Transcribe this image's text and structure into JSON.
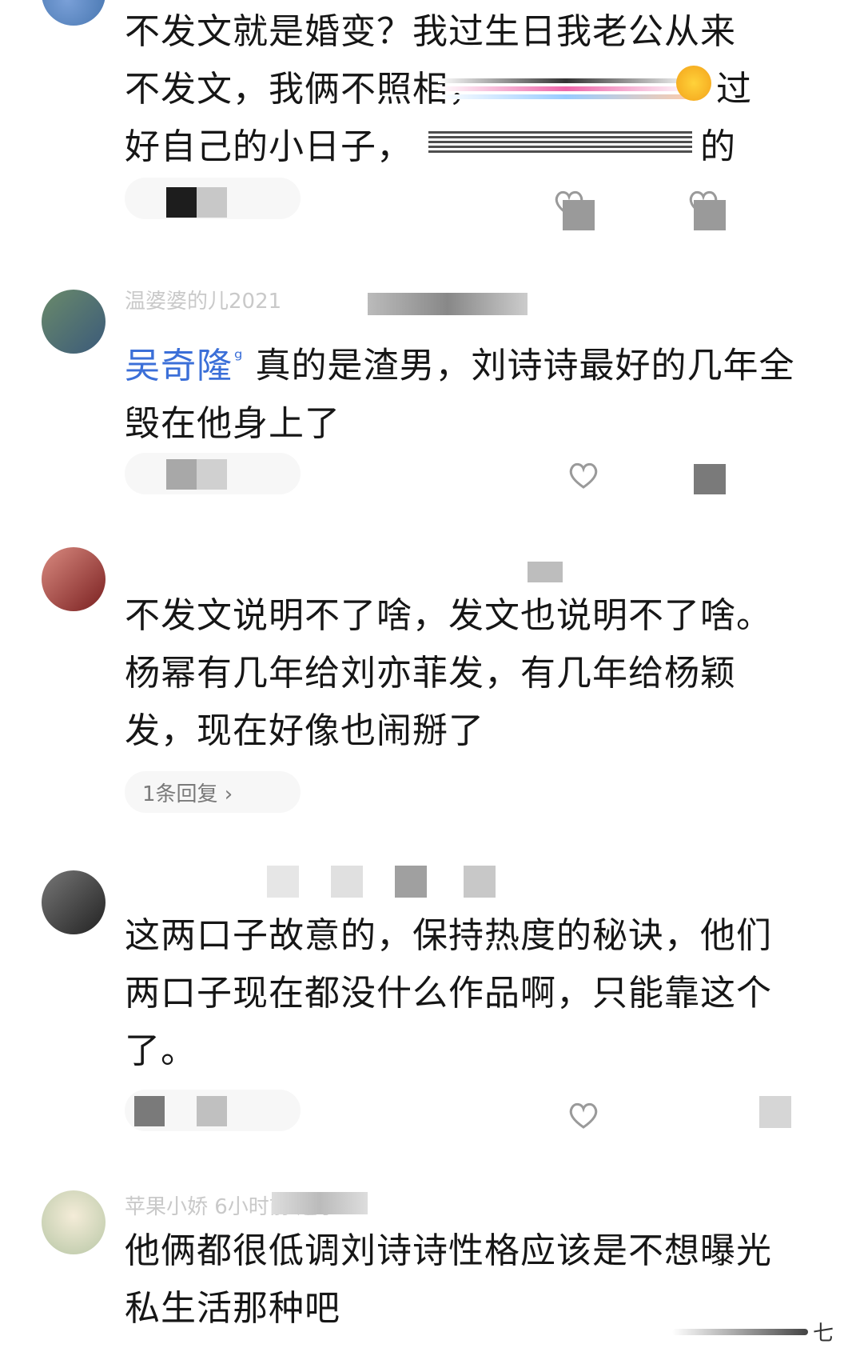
{
  "comments": [
    {
      "meta": "",
      "text_lines": [
        "不发文就是婚变？我过生日我老公从来",
        "不发文，我俩不照相，",
        "过",
        "好自己的小日子，",
        "的"
      ],
      "reply_label": ""
    },
    {
      "meta": "温婆婆的儿2021",
      "mention": "吴奇隆",
      "mention_mark": "ᵍ",
      "text": "真的是渣男，刘诗诗最好的几年全毁在他身上了",
      "reply_label": ""
    },
    {
      "meta": "",
      "text": "不发文说明不了啥，发文也说明不了啥。杨幂有几年给刘亦菲发，有几年给杨颖发，现在好像也闹掰了",
      "reply_label": "1条回复 ›"
    },
    {
      "meta": "",
      "text": "这两口子故意的，保持热度的秘诀，他们两口子现在都没什么作品啊，只能靠这个了。",
      "reply_label": ""
    },
    {
      "meta": "苹果小娇 6小时前 辽宁",
      "text": "他俩都很低调刘诗诗性格应该是不想曝光私生活那种吧",
      "reply_label": ""
    }
  ],
  "corner_label": "七",
  "icons": {
    "like": "heart-icon",
    "reply": "reply-pill"
  },
  "colors": {
    "mention": "#3b6fd8",
    "text": "#161616",
    "meta": "#c9c9c9"
  }
}
